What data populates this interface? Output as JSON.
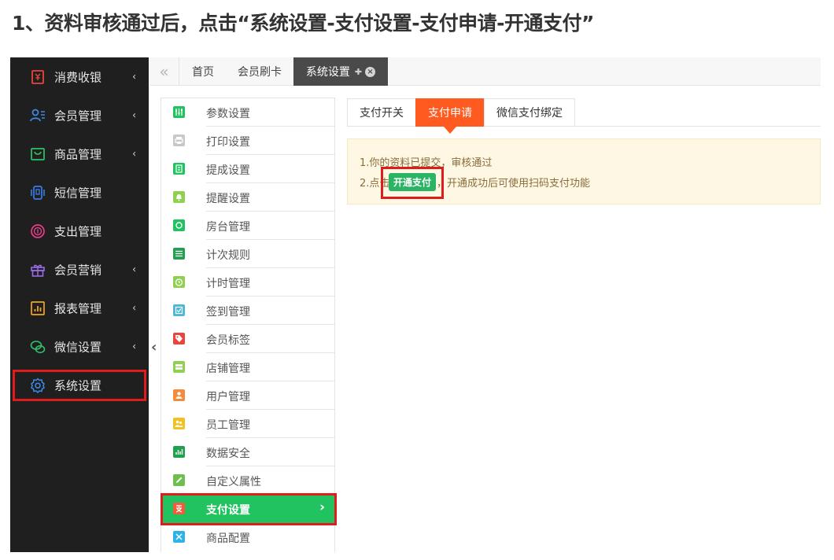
{
  "doc": {
    "title": "1、资料审核通过后，点击“系统设置-支付设置-支付申请-开通支付”"
  },
  "colors": {
    "sidebar_bg": "#1f1f1f",
    "accent_green": "#21c260",
    "accent_orange": "#ff5a1f",
    "highlight_red": "#e01b1b",
    "notice_bg": "#fdf7e3"
  },
  "sidebar": {
    "items": [
      {
        "label": "消费收银",
        "icon": "cashier-icon",
        "icon_color": "#e8453c",
        "has_arrow": true
      },
      {
        "label": "会员管理",
        "icon": "members-icon",
        "icon_color": "#3c8ce7",
        "has_arrow": true
      },
      {
        "label": "商品管理",
        "icon": "product-icon",
        "icon_color": "#2fc26b",
        "has_arrow": true
      },
      {
        "label": "短信管理",
        "icon": "sms-icon",
        "icon_color": "#3c7ae7",
        "has_arrow": false
      },
      {
        "label": "支出管理",
        "icon": "expense-icon",
        "icon_color": "#e83c8c",
        "has_arrow": false
      },
      {
        "label": "会员营销",
        "icon": "gift-icon",
        "icon_color": "#9b6ce8",
        "has_arrow": true
      },
      {
        "label": "报表管理",
        "icon": "report-icon",
        "icon_color": "#f2a51f",
        "has_arrow": true
      },
      {
        "label": "微信设置",
        "icon": "wechat-icon",
        "icon_color": "#2fc26b",
        "has_arrow": true
      },
      {
        "label": "系统设置",
        "icon": "gear-icon",
        "icon_color": "#3c8ce7",
        "has_arrow": false
      }
    ],
    "arrow_glyph": "‹",
    "collapse_glyph": "‹"
  },
  "tabbar": {
    "back_glyph": "«",
    "tabs": [
      {
        "label": "首页",
        "active": false
      },
      {
        "label": "会员刷卡",
        "active": false
      },
      {
        "label": "系统设置",
        "active": true,
        "pin_glyph": "✚",
        "close_glyph": "×"
      }
    ]
  },
  "settings_list": {
    "items": [
      {
        "label": "参数设置",
        "icon": "params-icon",
        "color": "#21c260"
      },
      {
        "label": "打印设置",
        "icon": "printer-icon",
        "color": "#c8c8c8"
      },
      {
        "label": "提成设置",
        "icon": "commission-icon",
        "color": "#21c260"
      },
      {
        "label": "提醒设置",
        "icon": "bell-icon",
        "color": "#8fd14f"
      },
      {
        "label": "房台管理",
        "icon": "room-icon",
        "color": "#21c260"
      },
      {
        "label": "计次规则",
        "icon": "count-rule-icon",
        "color": "#21a050"
      },
      {
        "label": "计时管理",
        "icon": "clock-icon",
        "color": "#8fd14f"
      },
      {
        "label": "签到管理",
        "icon": "checkin-icon",
        "color": "#4cb8d8"
      },
      {
        "label": "会员标签",
        "icon": "tag-icon",
        "color": "#e8453c"
      },
      {
        "label": "店铺管理",
        "icon": "store-icon",
        "color": "#8fd14f"
      },
      {
        "label": "用户管理",
        "icon": "user-icon",
        "color": "#f58a3c"
      },
      {
        "label": "员工管理",
        "icon": "staff-icon",
        "color": "#f2c01f"
      },
      {
        "label": "数据安全",
        "icon": "data-security-icon",
        "color": "#21a050"
      },
      {
        "label": "自定义属性",
        "icon": "edit-icon",
        "color": "#6fbf4f"
      },
      {
        "label": "支付设置",
        "icon": "payment-icon",
        "color": "#f25c3c",
        "active": true
      },
      {
        "label": "商品配置",
        "icon": "tools-icon",
        "color": "#2ab4e8"
      }
    ],
    "active_arrow": "›"
  },
  "subtabs": {
    "items": [
      {
        "label": "支付开关",
        "active": false
      },
      {
        "label": "支付申请",
        "active": true
      },
      {
        "label": "微信支付绑定",
        "active": false
      }
    ]
  },
  "notice": {
    "line1": "1.你的资料已提交，审核通过",
    "line2_prefix": "2.点击",
    "button_label": "开通支付",
    "line2_suffix": "，开通成功后可使用扫码支付功能"
  }
}
